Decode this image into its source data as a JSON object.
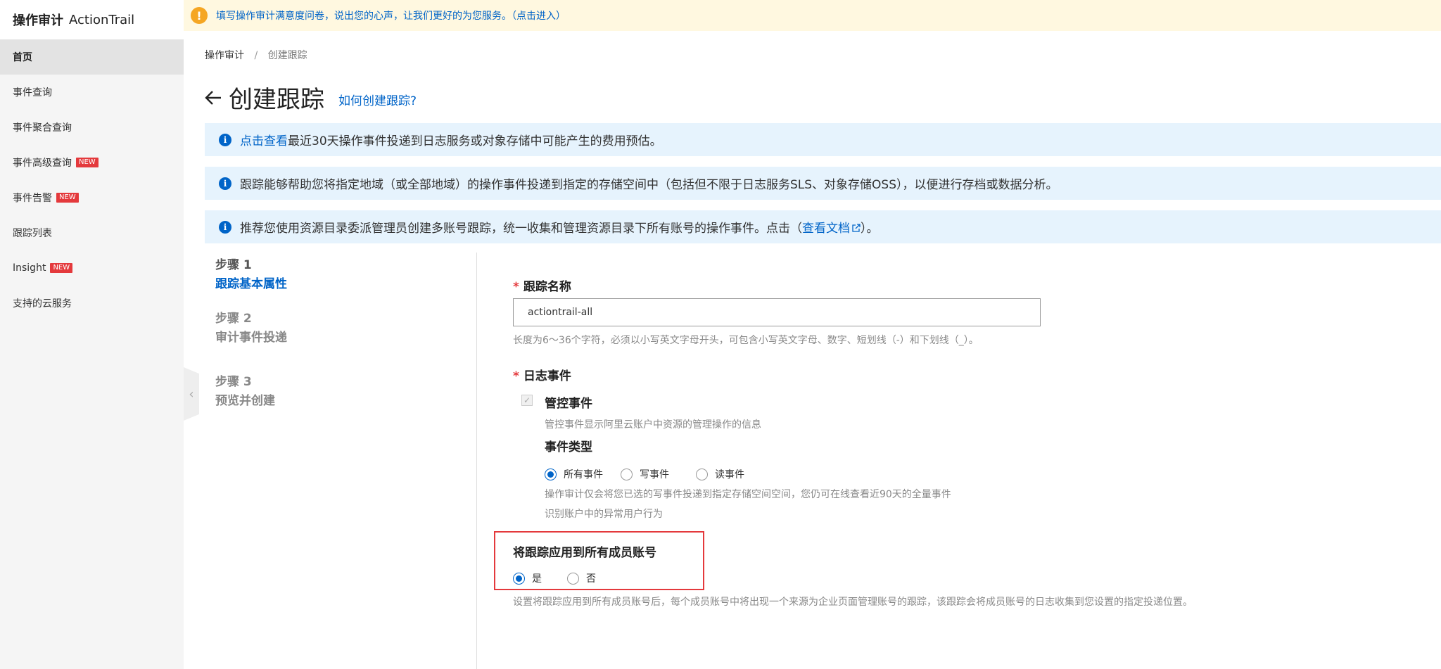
{
  "app": {
    "title": "操作审计",
    "title_en": "ActionTrail"
  },
  "sidebar": {
    "items": [
      {
        "label": "首页",
        "active": true
      },
      {
        "label": "事件查询"
      },
      {
        "label": "事件聚合查询"
      },
      {
        "label": "事件高级查询",
        "badge": "NEW"
      },
      {
        "label": "事件告警",
        "badge": "NEW"
      },
      {
        "label": "跟踪列表"
      },
      {
        "label": "Insight",
        "badge": "NEW"
      },
      {
        "label": "支持的云服务"
      }
    ]
  },
  "notice": {
    "text": "填写操作审计满意度问卷，说出您的心声，让我们更好的为您服务。（点击进入）"
  },
  "breadcrumb": {
    "root": "操作审计",
    "sep": "/",
    "current": "创建跟踪"
  },
  "header": {
    "title": "创建跟踪",
    "help_link": "如何创建跟踪?"
  },
  "info": {
    "box1": {
      "link": "点击查看",
      "text": "最近30天操作事件投递到日志服务或对象存储中可能产生的费用预估。"
    },
    "box2": {
      "text": "跟踪能够帮助您将指定地域（或全部地域）的操作事件投递到指定的存储空间中（包括但不限于日志服务SLS、对象存储OSS），以便进行存档或数据分析。"
    },
    "box3": {
      "text_before": "推荐您使用资源目录委派管理员创建多账号跟踪，统一收集和管理资源目录下所有账号的操作事件。点击（",
      "link": "查看文档",
      "text_after": "）。"
    }
  },
  "steps": [
    {
      "num": "步骤 1",
      "name": "跟踪基本属性",
      "active": true
    },
    {
      "num": "步骤 2",
      "name": "审计事件投递"
    },
    {
      "num": "步骤 3",
      "name": "预览并创建"
    }
  ],
  "form": {
    "trail_name": {
      "required_mark": "*",
      "label": "跟踪名称",
      "value": "actiontrail-all",
      "hint": "长度为6～36个字符，必须以小写英文字母开头，可包含小写英文字母、数字、短划线（-）和下划线（_）。"
    },
    "log_events": {
      "required_mark": "*",
      "label": "日志事件",
      "mgmt_checkbox_label": "管控事件",
      "mgmt_hint": "管控事件显示阿里云账户中资源的管理操作的信息",
      "event_type_label": "事件类型",
      "event_type_options": [
        "所有事件",
        "写事件",
        "读事件"
      ],
      "event_type_selected": "所有事件",
      "hint1": "操作审计仅会将您已选的写事件投递到指定存储空间空间，您仍可在线查看近90天的全量事件",
      "hint2": "识别账户中的异常用户行为"
    },
    "apply_all": {
      "label": "将跟踪应用到所有成员账号",
      "options": [
        "是",
        "否"
      ],
      "selected": "是",
      "hint": "设置将跟踪应用到所有成员账号后，每个成员账号中将出现一个来源为企业页面管理账号的跟踪，该跟踪会将成员账号的日志收集到您设置的指定投递位置。"
    }
  },
  "colors": {
    "accent": "#0064c8",
    "danger": "#e4393c",
    "notice_bg": "#fff8e0",
    "info_bg": "#e6f3fd"
  }
}
